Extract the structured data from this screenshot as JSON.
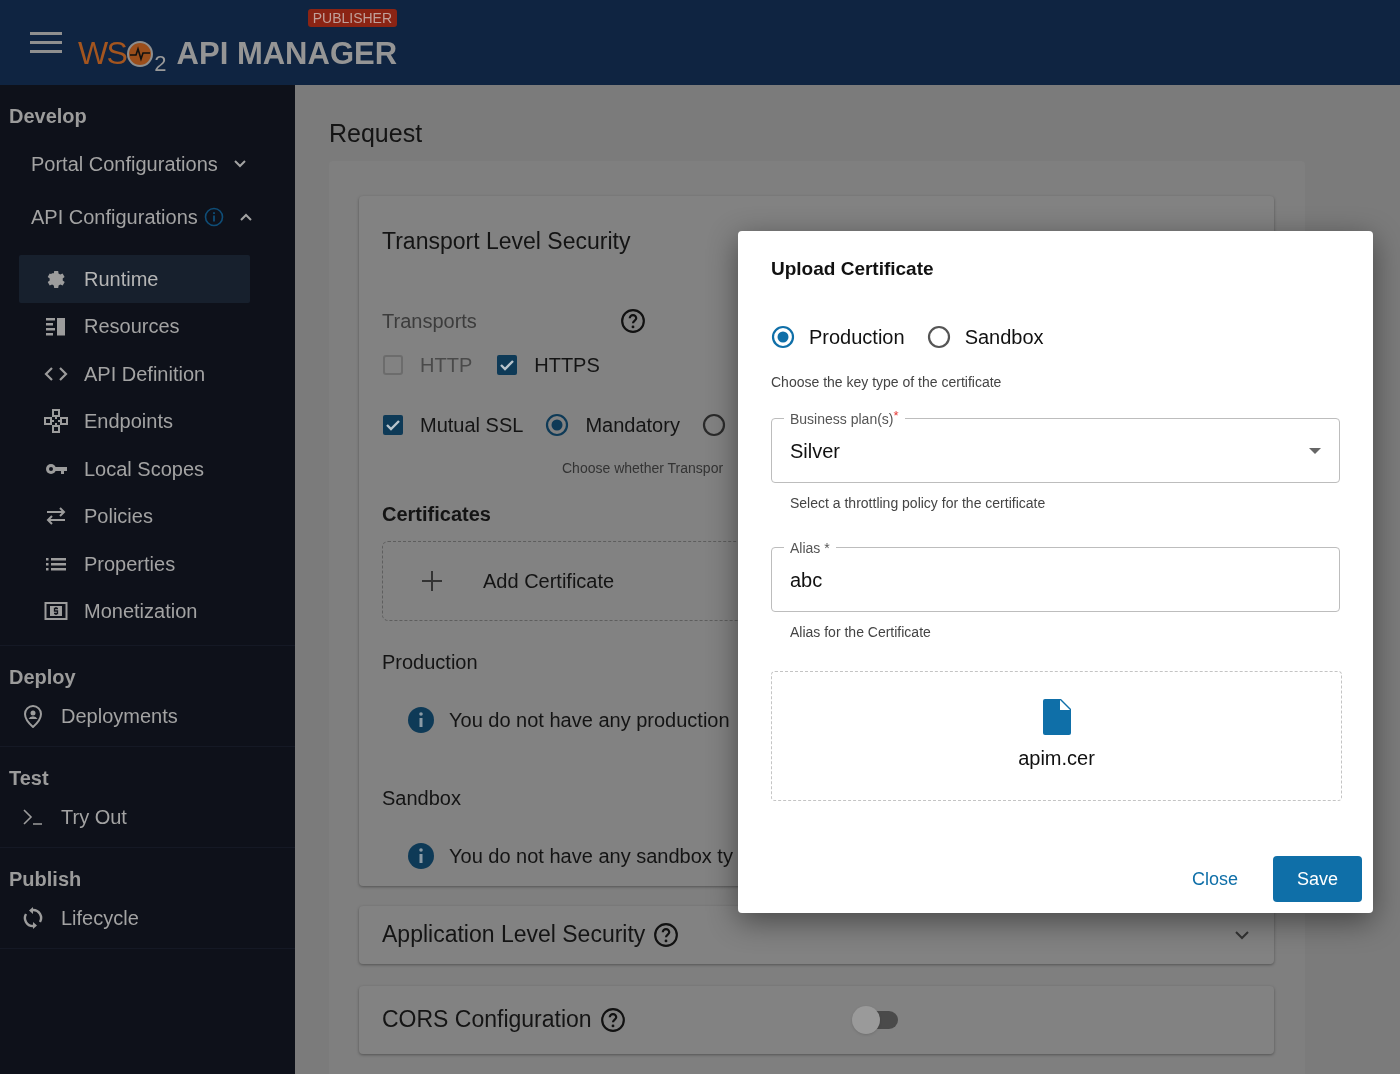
{
  "header": {
    "logo": {
      "text": "WS",
      "subscript": "2"
    },
    "product": "API MANAGER",
    "badge": "PUBLISHER"
  },
  "sidebar": {
    "sections": [
      {
        "title": "Develop",
        "items": [
          {
            "label": "Portal Configurations",
            "kind": "group",
            "expanded": false,
            "selected": false
          },
          {
            "label": "API Configurations",
            "kind": "group",
            "expanded": true,
            "info": true,
            "selected": false,
            "children": [
              {
                "label": "Runtime",
                "selected": true
              },
              {
                "label": "Resources",
                "selected": false
              },
              {
                "label": "API Definition",
                "selected": false
              },
              {
                "label": "Endpoints",
                "selected": false
              },
              {
                "label": "Local Scopes",
                "selected": false
              },
              {
                "label": "Policies",
                "selected": false
              },
              {
                "label": "Properties",
                "selected": false
              },
              {
                "label": "Monetization",
                "selected": false
              }
            ]
          }
        ]
      },
      {
        "title": "Deploy",
        "items": [
          {
            "label": "Deployments",
            "kind": "link",
            "selected": false
          }
        ]
      },
      {
        "title": "Test",
        "items": [
          {
            "label": "Try Out",
            "kind": "link",
            "selected": false
          }
        ]
      },
      {
        "title": "Publish",
        "items": [
          {
            "label": "Lifecycle",
            "kind": "link",
            "selected": false
          }
        ]
      }
    ]
  },
  "main": {
    "title": "Request",
    "transport": {
      "title": "Transport Level Security",
      "transports_label": "Transports",
      "transports": [
        {
          "label": "HTTP",
          "checked": false,
          "disabled": true
        },
        {
          "label": "HTTPS",
          "checked": true,
          "disabled": false
        }
      ],
      "mutual_ssl": {
        "label": "Mutual SSL",
        "checked": true
      },
      "ssl_modes": [
        {
          "label": "Mandatory",
          "selected": true
        },
        {
          "selected": false
        }
      ],
      "hint": "Choose whether Transpor",
      "certificates_title": "Certificates",
      "add_certificate": "Add Certificate",
      "groups": [
        {
          "title": "Production",
          "message": "You do not have any production"
        },
        {
          "title": "Sandbox",
          "message": "You do not have any sandbox ty"
        }
      ]
    },
    "application": {
      "title": "Application Level Security",
      "expanded": false
    },
    "cors": {
      "title": "CORS Configuration",
      "on": false
    }
  },
  "dialog": {
    "title": "Upload Certificate",
    "key_types": [
      {
        "label": "Production",
        "selected": true
      },
      {
        "label": "Sandbox",
        "selected": false
      }
    ],
    "key_type_hint": "Choose the key type of the certificate",
    "plan": {
      "label": "Business plan(s)",
      "required_mark": "*",
      "value": "Silver",
      "hint": "Select a throttling policy for the certificate"
    },
    "alias": {
      "label": "Alias",
      "required_mark": "*",
      "value": "abc",
      "hint": "Alias for the Certificate"
    },
    "file": {
      "name": "apim.cer"
    },
    "buttons": {
      "close": "Close",
      "save": "Save"
    }
  }
}
